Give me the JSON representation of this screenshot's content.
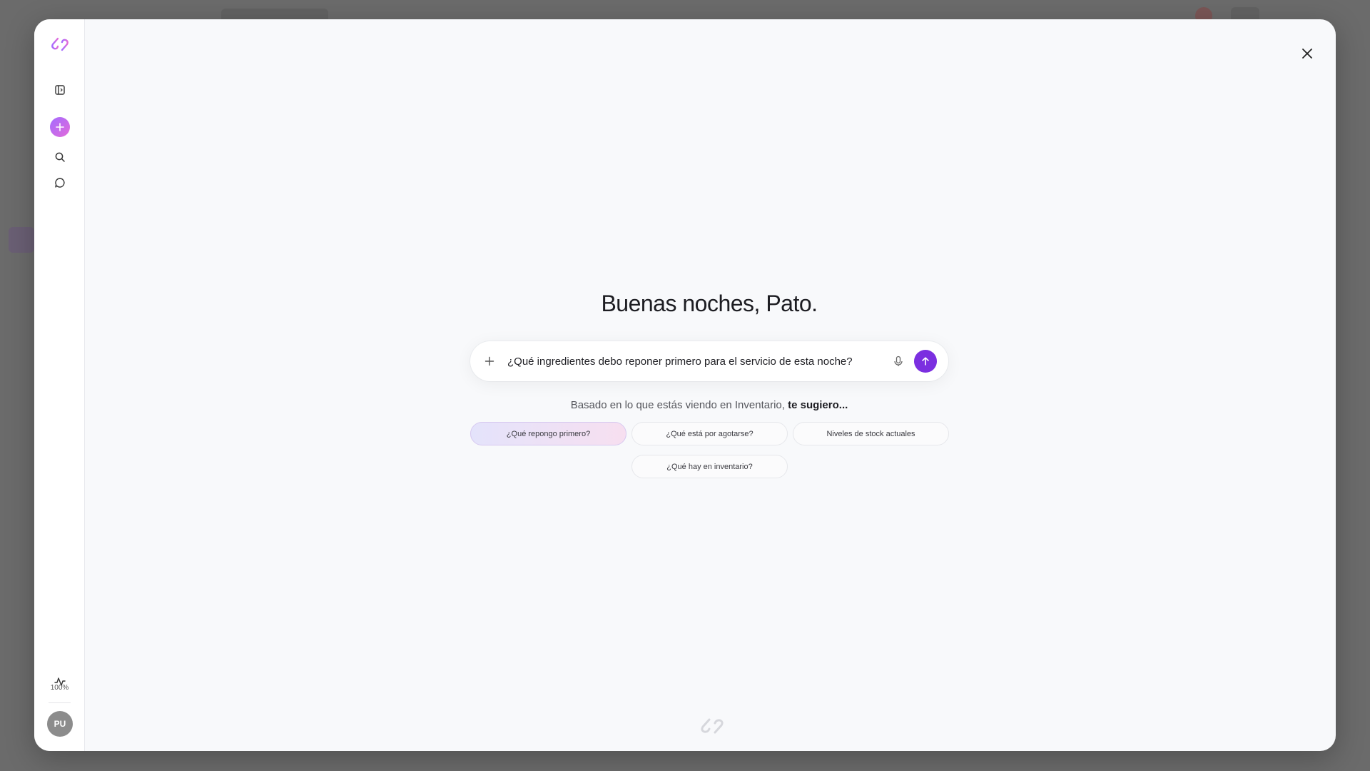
{
  "sidebar": {
    "logo_icon": "brand-logo-icon",
    "items": [
      {
        "name": "panel-toggle-icon"
      },
      {
        "name": "new-chat-icon"
      },
      {
        "name": "search-icon"
      },
      {
        "name": "chat-icon"
      }
    ],
    "activity_icon": "activity-icon",
    "zoom_level": "100%",
    "avatar_initials": "PU"
  },
  "main": {
    "greeting": "Buenas noches, Pato.",
    "composer": {
      "value": "¿Qué ingredientes debo reponer primero para el servicio de esta noche?"
    },
    "suggest_prefix": "Basado en lo que estás viendo en Inventario,",
    "suggest_emphasis": "te sugiero...",
    "chips": [
      {
        "label": "¿Qué repongo primero?",
        "active": true
      },
      {
        "label": "¿Qué está por agotarse?",
        "active": false
      },
      {
        "label": "Niveles de stock actuales",
        "active": false
      },
      {
        "label": "¿Qué hay en inventario?",
        "active": false
      }
    ]
  },
  "colors": {
    "accent": "#7b2fe0",
    "gradient_start": "#a46bff",
    "gradient_end": "#e26bd9",
    "backdrop": "#6d6d6d"
  }
}
